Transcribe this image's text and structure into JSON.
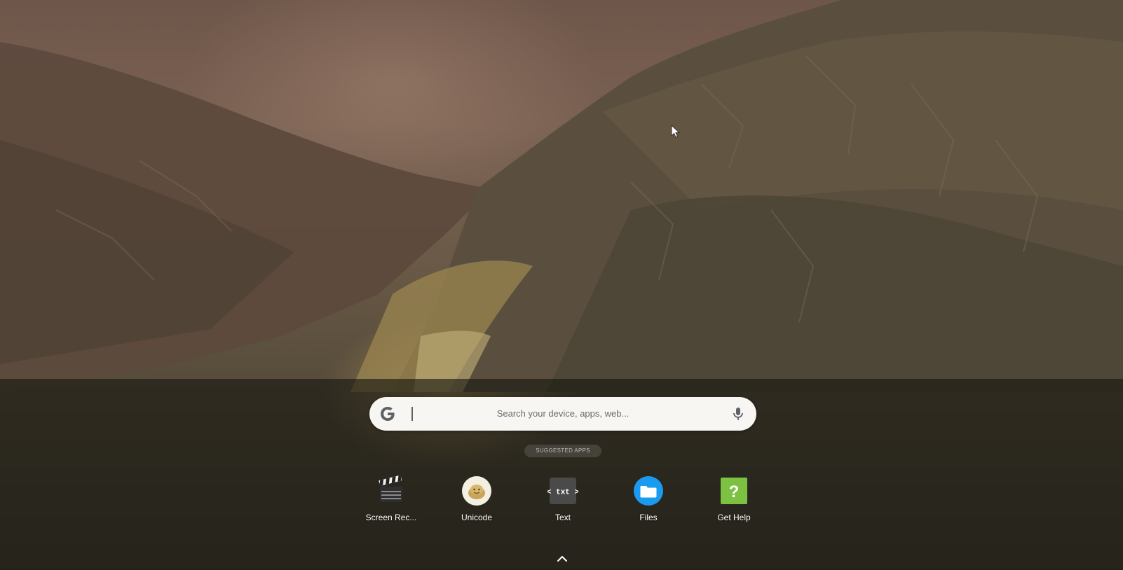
{
  "search": {
    "placeholder": "Search your device, apps, web..."
  },
  "suggested": {
    "label": "SUGGESTED APPS"
  },
  "apps": [
    {
      "label": "Screen Rec...",
      "icon": "clapperboard-icon"
    },
    {
      "label": "Unicode",
      "icon": "unicode-face-icon"
    },
    {
      "label": "Text",
      "icon": "text-editor-icon",
      "glyph": "< txt >"
    },
    {
      "label": "Files",
      "icon": "folder-icon"
    },
    {
      "label": "Get Help",
      "icon": "help-icon",
      "glyph": "?"
    }
  ],
  "colors": {
    "files_blue": "#1a9bf0",
    "help_green": "#7cc142",
    "text_gray": "#4a4a4a"
  }
}
